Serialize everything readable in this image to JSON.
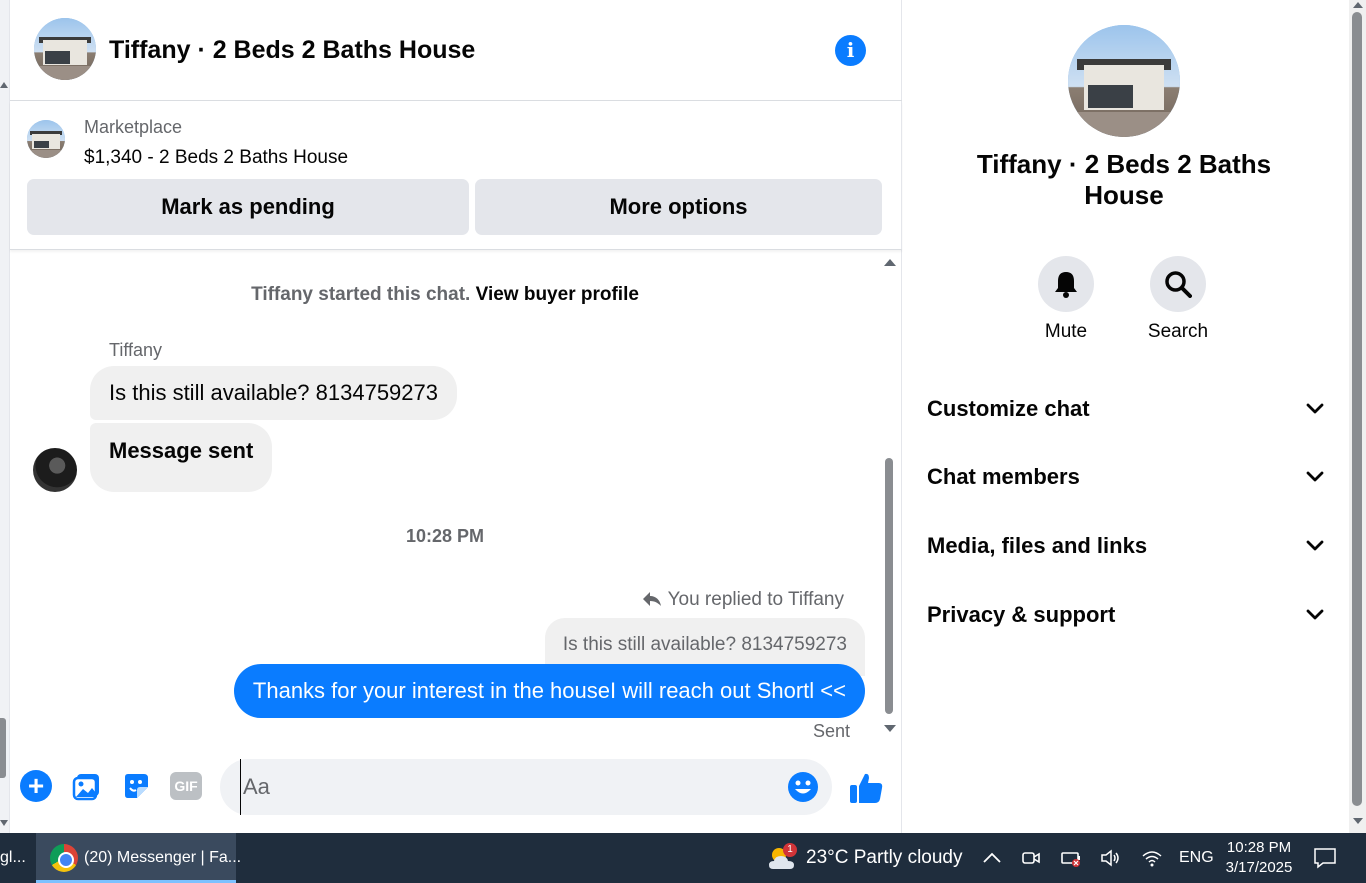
{
  "header": {
    "title": "Tiffany · 2 Beds 2 Baths House"
  },
  "listing": {
    "label": "Marketplace",
    "price_title": "$1,340 - 2 Beds 2 Baths House",
    "mark_pending": "Mark as pending",
    "more_options": "More options"
  },
  "messages": {
    "started_text": "Tiffany started this chat.",
    "view_profile": "View buyer profile",
    "sender": "Tiffany",
    "incoming_1": "Is this still available? 8134759273",
    "incoming_2": "Message sent",
    "timestamp": "10:28 PM",
    "replied_to": "You replied to Tiffany",
    "quoted": "Is this still available? 8134759273",
    "outgoing": "Thanks for your interest in the houseI will reach out Shortl <<",
    "status": "Sent"
  },
  "composer": {
    "placeholder": "Aa",
    "gif_label": "GIF"
  },
  "panel": {
    "title": "Tiffany · 2 Beds 2 Baths House",
    "mute": "Mute",
    "search": "Search",
    "sections": [
      "Customize chat",
      "Chat members",
      "Media, files and links",
      "Privacy & support"
    ]
  },
  "taskbar": {
    "prev_app": "gl...",
    "app_label": "(20) Messenger | Fa...",
    "weather": "23°C  Partly cloudy",
    "weather_badge": "1",
    "language": "ENG",
    "time": "10:28 PM",
    "date": "3/17/2025"
  },
  "colors": {
    "accent": "#0a7cff",
    "bubble_gray": "#f0f0f0",
    "button_gray": "#e4e6eb",
    "taskbar": "#1f2d3d"
  }
}
